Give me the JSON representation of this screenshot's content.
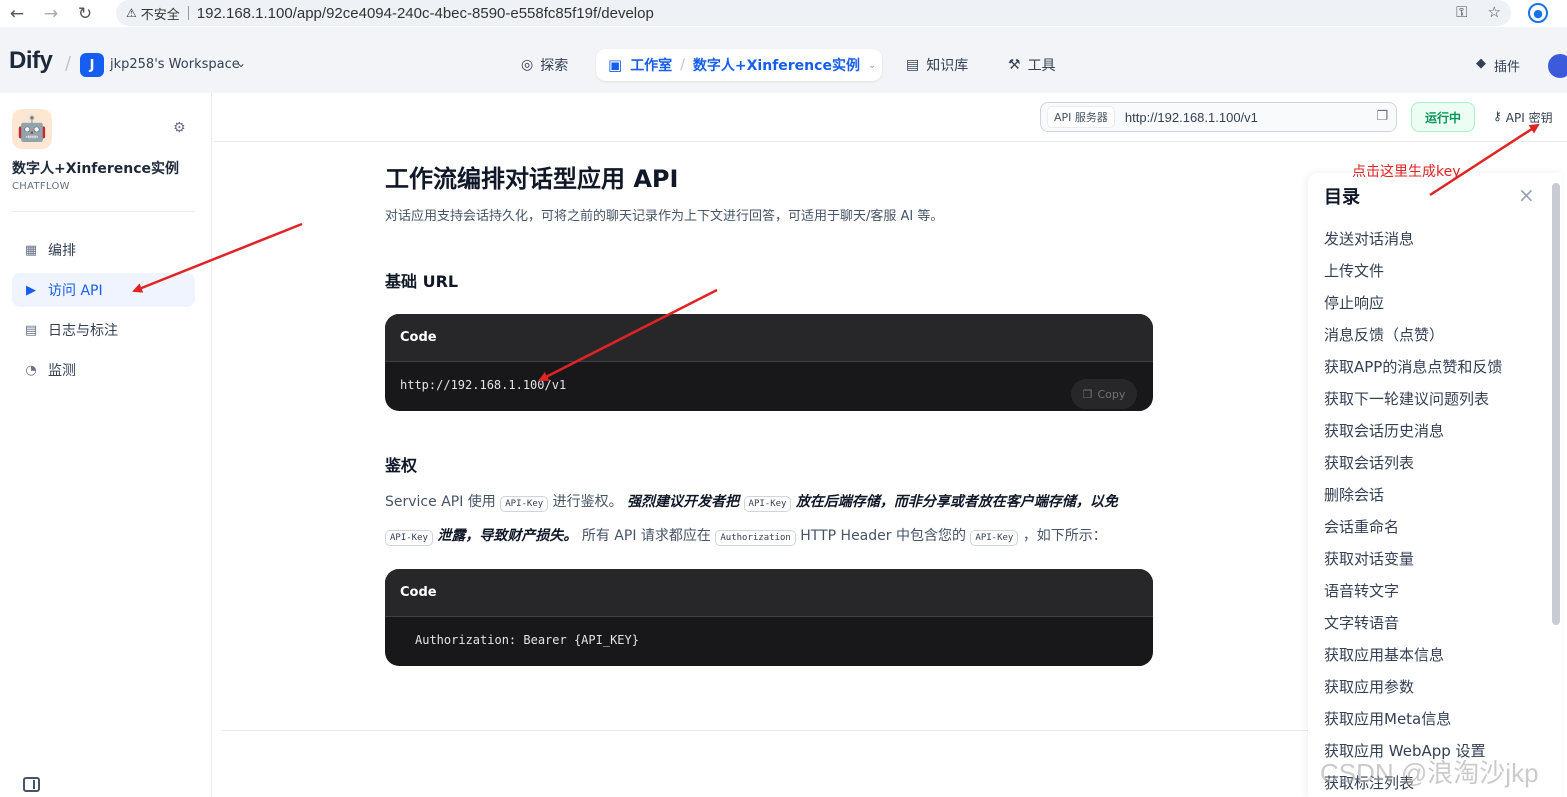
{
  "browser": {
    "insecure_label": "不安全",
    "url": "192.168.1.100/app/92ce4094-240c-4bec-8590-e558fc85f19f/develop"
  },
  "header": {
    "logo": "Dify",
    "workspace_initial": "J",
    "workspace_name": "jkp258's Workspace",
    "nav": {
      "explore": "探索",
      "studio": "工作室",
      "current_app": "数字人+Xinference实例",
      "knowledge": "知识库",
      "tools": "工具",
      "plugins": "插件"
    }
  },
  "sidebar": {
    "app_name": "数字人+Xinference实例",
    "app_type": "CHATFLOW",
    "items": [
      {
        "label": "编排",
        "active": false
      },
      {
        "label": "访问 API",
        "active": true
      },
      {
        "label": "日志与标注",
        "active": false
      },
      {
        "label": "监测",
        "active": false
      }
    ]
  },
  "main": {
    "api_server_label": "API 服务器",
    "api_server_url": "http://192.168.1.100/v1",
    "status": "运行中",
    "api_key_button": "API 密钥",
    "title": "工作流编排对话型应用 API",
    "description": "对话应用支持会话持久化，可将之前的聊天记录作为上下文进行回答，可适用于聊天/客服 AI 等。",
    "base_url_heading": "基础 URL",
    "code_label": "Code",
    "base_url_code": "http://192.168.1.100/v1",
    "copy_label": "Copy",
    "auth_heading": "鉴权",
    "auth_text": {
      "p1": "Service API 使用",
      "k1": "API-Key",
      "p2": "进行鉴权。",
      "b1": "强烈建议开发者把",
      "k2": "API-Key",
      "b2": "放在后端存储，而非分享或者放在客户端存储，以免",
      "k3": "API-Key",
      "b3": "泄露，导致财产损失。",
      "p3": "所有 API 请求都应在",
      "k4": "Authorization",
      "p4": "HTTP Header 中包含您的",
      "k5": "API-Key",
      "p5": "，如下所示："
    },
    "auth_code": "Authorization: Bearer {API_KEY}"
  },
  "toc": {
    "title": "目录",
    "items": [
      "发送对话消息",
      "上传文件",
      "停止响应",
      "消息反馈（点赞）",
      "获取APP的消息点赞和反馈",
      "获取下一轮建议问题列表",
      "获取会话历史消息",
      "获取会话列表",
      "删除会话",
      "会话重命名",
      "获取对话变量",
      "语音转文字",
      "文字转语音",
      "获取应用基本信息",
      "获取应用参数",
      "获取应用Meta信息",
      "获取应用 WebApp 设置",
      "获取标注列表"
    ]
  },
  "annotation": {
    "text": "点击这里生成key",
    "color": "#e02424"
  },
  "watermark": "CSDN @浪淘沙jkp"
}
